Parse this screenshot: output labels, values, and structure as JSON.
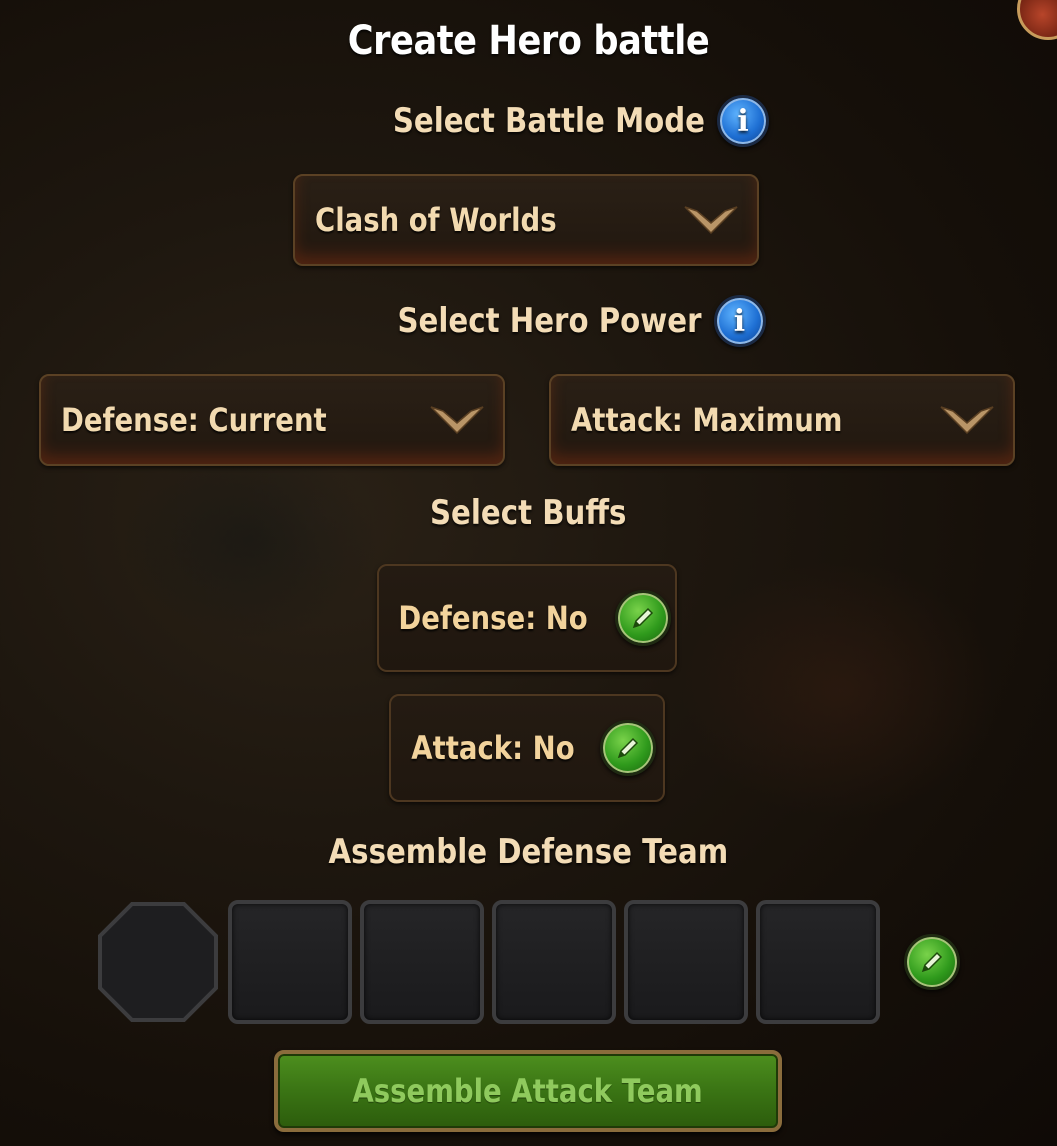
{
  "dialog": {
    "title": "Create Hero battle"
  },
  "battle_mode": {
    "label": "Select Battle Mode",
    "selected": "Clash of Worlds"
  },
  "hero_power": {
    "label": "Select Hero Power",
    "defense_selected": "Defense: Current",
    "attack_selected": "Attack: Maximum"
  },
  "buffs": {
    "label": "Select Buffs",
    "defense": "Defense: No",
    "attack": "Attack: No"
  },
  "defense_team": {
    "label": "Assemble Defense Team",
    "slot_count": 6
  },
  "attack_team": {
    "button_label": "Assemble Attack Team"
  },
  "icons": {
    "info": "info-icon",
    "edit": "pencil-icon",
    "dropdown": "chevron-down-icon"
  },
  "colors": {
    "label_text": "#f3dcb6",
    "info_blue": "#1e6fd3",
    "edit_green": "#2f9a1c",
    "button_green": "#3a7414",
    "button_text": "#8fca5d"
  }
}
